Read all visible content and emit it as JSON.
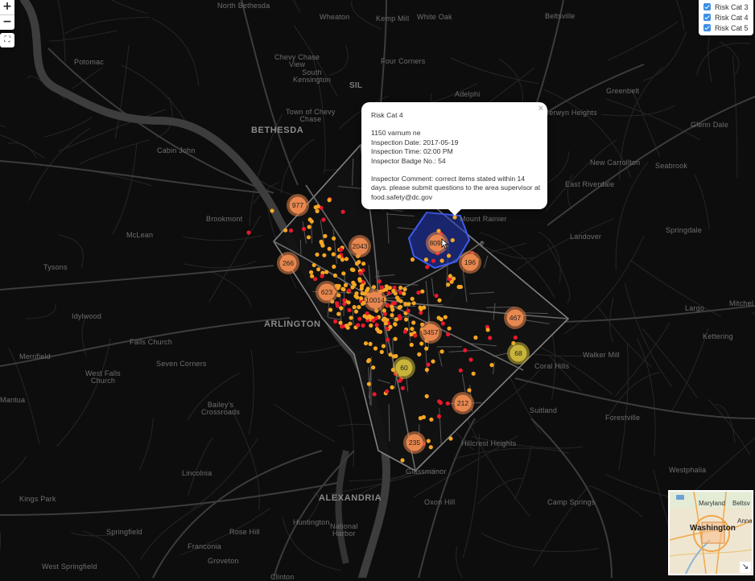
{
  "controls": {
    "zoom_in": "+",
    "zoom_out": "−",
    "fullscreen": "⛶"
  },
  "layers": [
    {
      "label": "Risk Cat 3",
      "checked": true
    },
    {
      "label": "Risk Cat 4",
      "checked": true
    },
    {
      "label": "Risk Cat 5",
      "checked": true
    }
  ],
  "popup": {
    "title": "Risk Cat 4",
    "address": "1150 varnum ne",
    "inspection_date": "Inspection Date: 2017-05-19",
    "inspection_time": "Inspection Time: 02:00 PM",
    "badge": "Inspector Badge No.: 54",
    "comment_line1": "Inspector Comment: correct items stated within 14",
    "comment_line2": "days. please submit questions to the area supervisor at",
    "comment_line3": "food.safety@dc.gov",
    "close": "×"
  },
  "clusters": [
    {
      "count": "977",
      "color": "#e8874e"
    },
    {
      "count": "2043",
      "color": "#e8874e"
    },
    {
      "count": "266",
      "color": "#e8874e"
    },
    {
      "count": "8093",
      "color": "#e8874e"
    },
    {
      "count": "196",
      "color": "#e8874e"
    },
    {
      "count": "623",
      "color": "#e8874e"
    },
    {
      "count": "10014",
      "color": "#e8874e"
    },
    {
      "count": "467",
      "color": "#e8874e"
    },
    {
      "count": "3457",
      "color": "#e8874e"
    },
    {
      "count": "68",
      "color": "#c9b43a"
    },
    {
      "count": "60",
      "color": "#c9b43a"
    },
    {
      "count": "212",
      "color": "#e8874e"
    },
    {
      "count": "235",
      "color": "#e8874e"
    }
  ],
  "places": [
    {
      "name": "North Bethesda",
      "cls": ""
    },
    {
      "name": "Wheaton",
      "cls": ""
    },
    {
      "name": "Kemp Mill",
      "cls": ""
    },
    {
      "name": "White Oak",
      "cls": ""
    },
    {
      "name": "Beltsville",
      "cls": ""
    },
    {
      "name": "Potomac",
      "cls": ""
    },
    {
      "name": "Chevy Chase\nView",
      "cls": ""
    },
    {
      "name": "South\nKensington",
      "cls": ""
    },
    {
      "name": "Four Corners",
      "cls": ""
    },
    {
      "name": "SIL",
      "cls": "big"
    },
    {
      "name": "Adelphi",
      "cls": ""
    },
    {
      "name": "Greenbelt",
      "cls": ""
    },
    {
      "name": "BETHESDA",
      "cls": "major"
    },
    {
      "name": "Town of Chevy\nChase",
      "cls": ""
    },
    {
      "name": "Berwyn Heights",
      "cls": ""
    },
    {
      "name": "Glenn Dale",
      "cls": ""
    },
    {
      "name": "Cabin John",
      "cls": ""
    },
    {
      "name": "New Carrollton",
      "cls": ""
    },
    {
      "name": "Seabrook",
      "cls": ""
    },
    {
      "name": "East Riverdale",
      "cls": ""
    },
    {
      "name": "Brookmont",
      "cls": ""
    },
    {
      "name": "Mount Rainier",
      "cls": ""
    },
    {
      "name": "McLean",
      "cls": ""
    },
    {
      "name": "Landover",
      "cls": ""
    },
    {
      "name": "Springdale",
      "cls": ""
    },
    {
      "name": "Tysons",
      "cls": ""
    },
    {
      "name": "Idylwood",
      "cls": ""
    },
    {
      "name": "ARLINGTON",
      "cls": "major"
    },
    {
      "name": "Largo",
      "cls": ""
    },
    {
      "name": "Mitchel",
      "cls": ""
    },
    {
      "name": "Kettering",
      "cls": ""
    },
    {
      "name": "Falls Church",
      "cls": ""
    },
    {
      "name": "Walker Mill",
      "cls": ""
    },
    {
      "name": "Merrifield",
      "cls": ""
    },
    {
      "name": "Seven Corners",
      "cls": ""
    },
    {
      "name": "West Falls\nChurch",
      "cls": ""
    },
    {
      "name": "Coral Hills",
      "cls": ""
    },
    {
      "name": "Mantua",
      "cls": ""
    },
    {
      "name": "Bailey's\nCrossroads",
      "cls": ""
    },
    {
      "name": "Suitland",
      "cls": ""
    },
    {
      "name": "Forestville",
      "cls": ""
    },
    {
      "name": "Lincolnia",
      "cls": ""
    },
    {
      "name": "Hillcrest Heights",
      "cls": ""
    },
    {
      "name": "Glassmanor",
      "cls": ""
    },
    {
      "name": "Westphalia",
      "cls": ""
    },
    {
      "name": "Kings Park",
      "cls": ""
    },
    {
      "name": "ALEXANDRIA",
      "cls": "major"
    },
    {
      "name": "Oxon Hill",
      "cls": ""
    },
    {
      "name": "Camp Springs",
      "cls": ""
    },
    {
      "name": "Springfield",
      "cls": ""
    },
    {
      "name": "Rose Hill",
      "cls": ""
    },
    {
      "name": "Huntington",
      "cls": ""
    },
    {
      "name": "National\nHarbor",
      "cls": ""
    },
    {
      "name": "Franconia",
      "cls": ""
    },
    {
      "name": "West Springfield",
      "cls": ""
    },
    {
      "name": "Groveton",
      "cls": ""
    },
    {
      "name": "Clinton",
      "cls": ""
    }
  ],
  "minimap": {
    "labels": [
      {
        "name": "Washington",
        "cls": "big"
      },
      {
        "name": "Maryland",
        "cls": ""
      },
      {
        "name": "Beltsv",
        "cls": ""
      },
      {
        "name": "Anna",
        "cls": ""
      }
    ],
    "toggle": "↘"
  },
  "colors": {
    "background": "#0d0d0d",
    "road": "#5a5a5a",
    "minor_road": "#2e2e2e",
    "point_cat4": "#f5a623",
    "point_cat5": "#e8192c",
    "cluster_orange": "#e8874e",
    "cluster_yellow": "#c9b43a",
    "selection": "#2f4fe0"
  }
}
